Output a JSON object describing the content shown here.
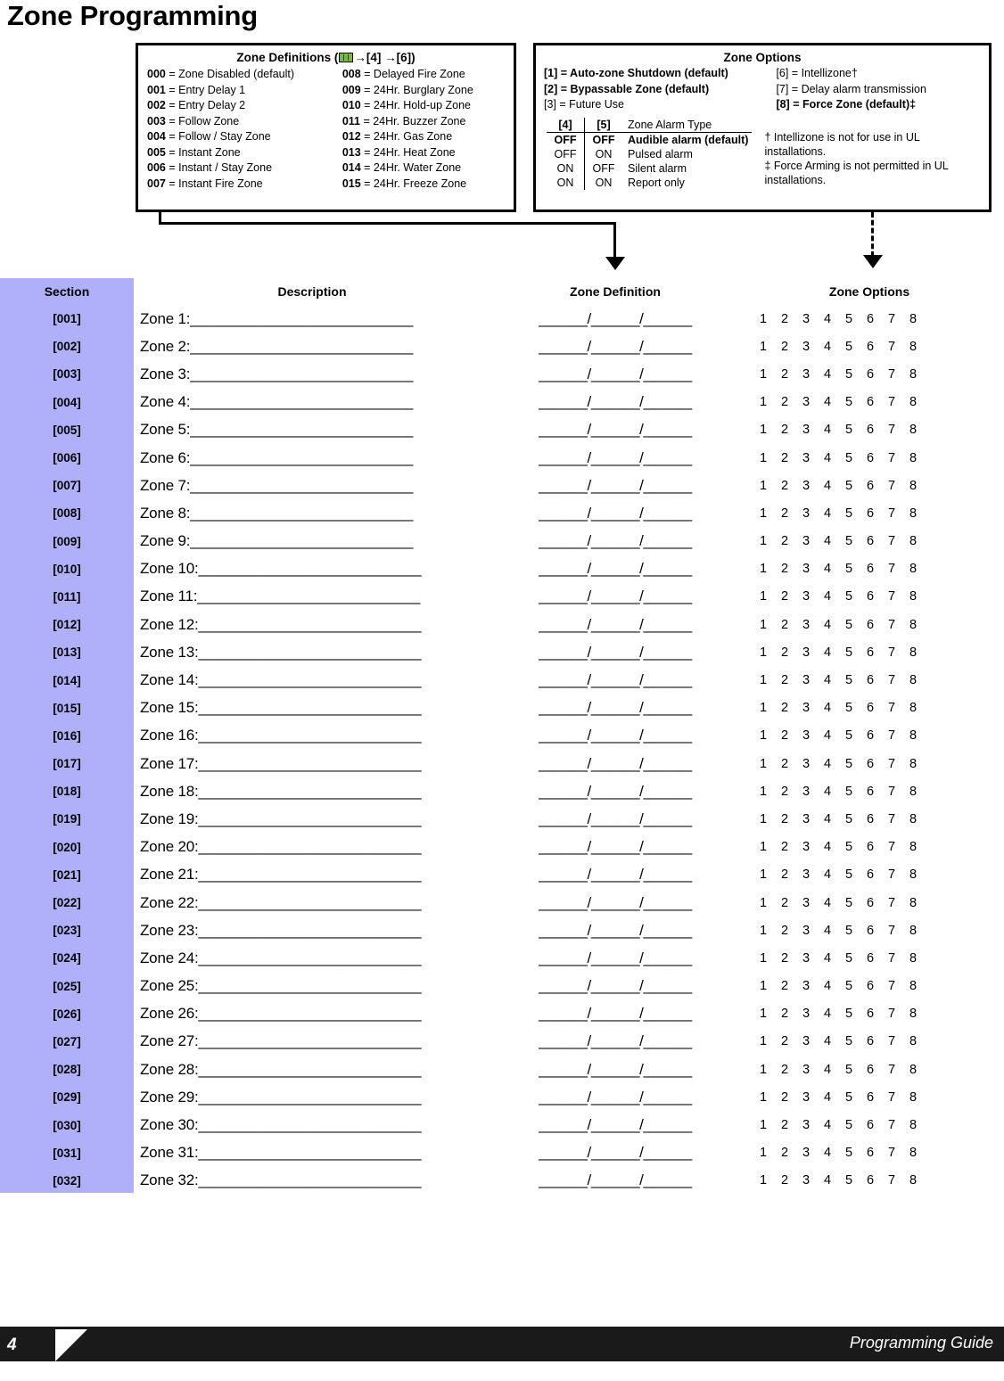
{
  "page": {
    "title": "Zone Programming",
    "footer_page_number": "4",
    "footer_label": "Programming Guide",
    "sidebar_color": "#b0b0fa",
    "keypad_icon_color": "#7ab648"
  },
  "zone_definitions_box": {
    "title_prefix": "Zone Definitions (",
    "title_icon": "keypad-icon",
    "title_keys": "→[4]  →[6]",
    "title_suffix": ")",
    "column_a": [
      {
        "code": "000",
        "label": "= Zone Disabled (default)"
      },
      {
        "code": "001",
        "label": "= Entry Delay 1"
      },
      {
        "code": "002",
        "label": "= Entry Delay 2"
      },
      {
        "code": "003",
        "label": "= Follow Zone"
      },
      {
        "code": "004",
        "label": "= Follow / Stay Zone"
      },
      {
        "code": "005",
        "label": "= Instant Zone"
      },
      {
        "code": "006",
        "label": "= Instant / Stay Zone"
      },
      {
        "code": "007",
        "label": "= Instant Fire Zone"
      }
    ],
    "column_b": [
      {
        "code": "008",
        "label": "= Delayed Fire Zone"
      },
      {
        "code": "009",
        "label": "= 24Hr. Burglary Zone"
      },
      {
        "code": "010",
        "label": "= 24Hr. Hold-up Zone"
      },
      {
        "code": "011",
        "label": "= 24Hr. Buzzer Zone"
      },
      {
        "code": "012",
        "label": "= 24Hr. Gas Zone"
      },
      {
        "code": "013",
        "label": "= 24Hr. Heat Zone"
      },
      {
        "code": "014",
        "label": "= 24Hr. Water Zone"
      },
      {
        "code": "015",
        "label": "= 24Hr. Freeze Zone"
      }
    ]
  },
  "zone_options_box": {
    "title": "Zone Options",
    "column_a": [
      {
        "text": "[1] = Auto-zone Shutdown (default)",
        "bold": true
      },
      {
        "text": "[2] = Bypassable Zone (default)",
        "bold": true
      },
      {
        "text": "[3] = Future Use",
        "bold": false
      }
    ],
    "column_b": [
      {
        "text": "[6] = Intellizone†",
        "bold": false
      },
      {
        "text": "[7] = Delay alarm transmission",
        "bold": false
      },
      {
        "text": "[8] = Force Zone (default)‡",
        "bold": true
      }
    ],
    "alarm_table": {
      "header": {
        "c4": "[4]",
        "c5": "[5]",
        "label": "Zone Alarm Type"
      },
      "rows": [
        {
          "c4": "OFF",
          "c5": "OFF",
          "label": "Audible alarm (default)",
          "default": true
        },
        {
          "c4": "OFF",
          "c5": "ON",
          "label": "Pulsed alarm",
          "default": false
        },
        {
          "c4": "ON",
          "c5": "OFF",
          "label": "Silent alarm",
          "default": false
        },
        {
          "c4": "ON",
          "c5": "ON",
          "label": "Report only",
          "default": false
        }
      ]
    },
    "ul_notes": [
      "† Intellizone is not for use in UL installations.",
      "‡ Force Arming is not permitted in UL installations."
    ]
  },
  "table": {
    "headers": {
      "section": "Section",
      "description": "Description",
      "zone_definition": "Zone Definition",
      "zone_options": "Zone Options"
    },
    "blank_line": "___________________________",
    "definition_blanks": "______/______/______",
    "option_numbers": [
      "1",
      "2",
      "3",
      "4",
      "5",
      "6",
      "7",
      "8"
    ],
    "rows": [
      {
        "section": "[001]",
        "description": "Zone 1:"
      },
      {
        "section": "[002]",
        "description": "Zone 2:"
      },
      {
        "section": "[003]",
        "description": "Zone 3:"
      },
      {
        "section": "[004]",
        "description": "Zone 4:"
      },
      {
        "section": "[005]",
        "description": "Zone 5:"
      },
      {
        "section": "[006]",
        "description": "Zone 6:"
      },
      {
        "section": "[007]",
        "description": "Zone 7:"
      },
      {
        "section": "[008]",
        "description": "Zone 8:"
      },
      {
        "section": "[009]",
        "description": "Zone 9:"
      },
      {
        "section": "[010]",
        "description": "Zone 10:"
      },
      {
        "section": "[011]",
        "description": "Zone 11:"
      },
      {
        "section": "[012]",
        "description": "Zone 12:"
      },
      {
        "section": "[013]",
        "description": "Zone 13:"
      },
      {
        "section": "[014]",
        "description": "Zone 14:"
      },
      {
        "section": "[015]",
        "description": "Zone 15:"
      },
      {
        "section": "[016]",
        "description": "Zone 16:"
      },
      {
        "section": "[017]",
        "description": "Zone 17:"
      },
      {
        "section": "[018]",
        "description": "Zone 18:"
      },
      {
        "section": "[019]",
        "description": "Zone 19:"
      },
      {
        "section": "[020]",
        "description": "Zone 20:"
      },
      {
        "section": "[021]",
        "description": "Zone 21:"
      },
      {
        "section": "[022]",
        "description": "Zone 22:"
      },
      {
        "section": "[023]",
        "description": "Zone 23:"
      },
      {
        "section": "[024]",
        "description": "Zone 24:"
      },
      {
        "section": "[025]",
        "description": "Zone 25:"
      },
      {
        "section": "[026]",
        "description": "Zone 26:"
      },
      {
        "section": "[027]",
        "description": "Zone 27:"
      },
      {
        "section": "[028]",
        "description": "Zone 28:"
      },
      {
        "section": "[029]",
        "description": "Zone 29:"
      },
      {
        "section": "[030]",
        "description": "Zone 30:"
      },
      {
        "section": "[031]",
        "description": "Zone 31:"
      },
      {
        "section": "[032]",
        "description": "Zone 32:"
      }
    ]
  }
}
